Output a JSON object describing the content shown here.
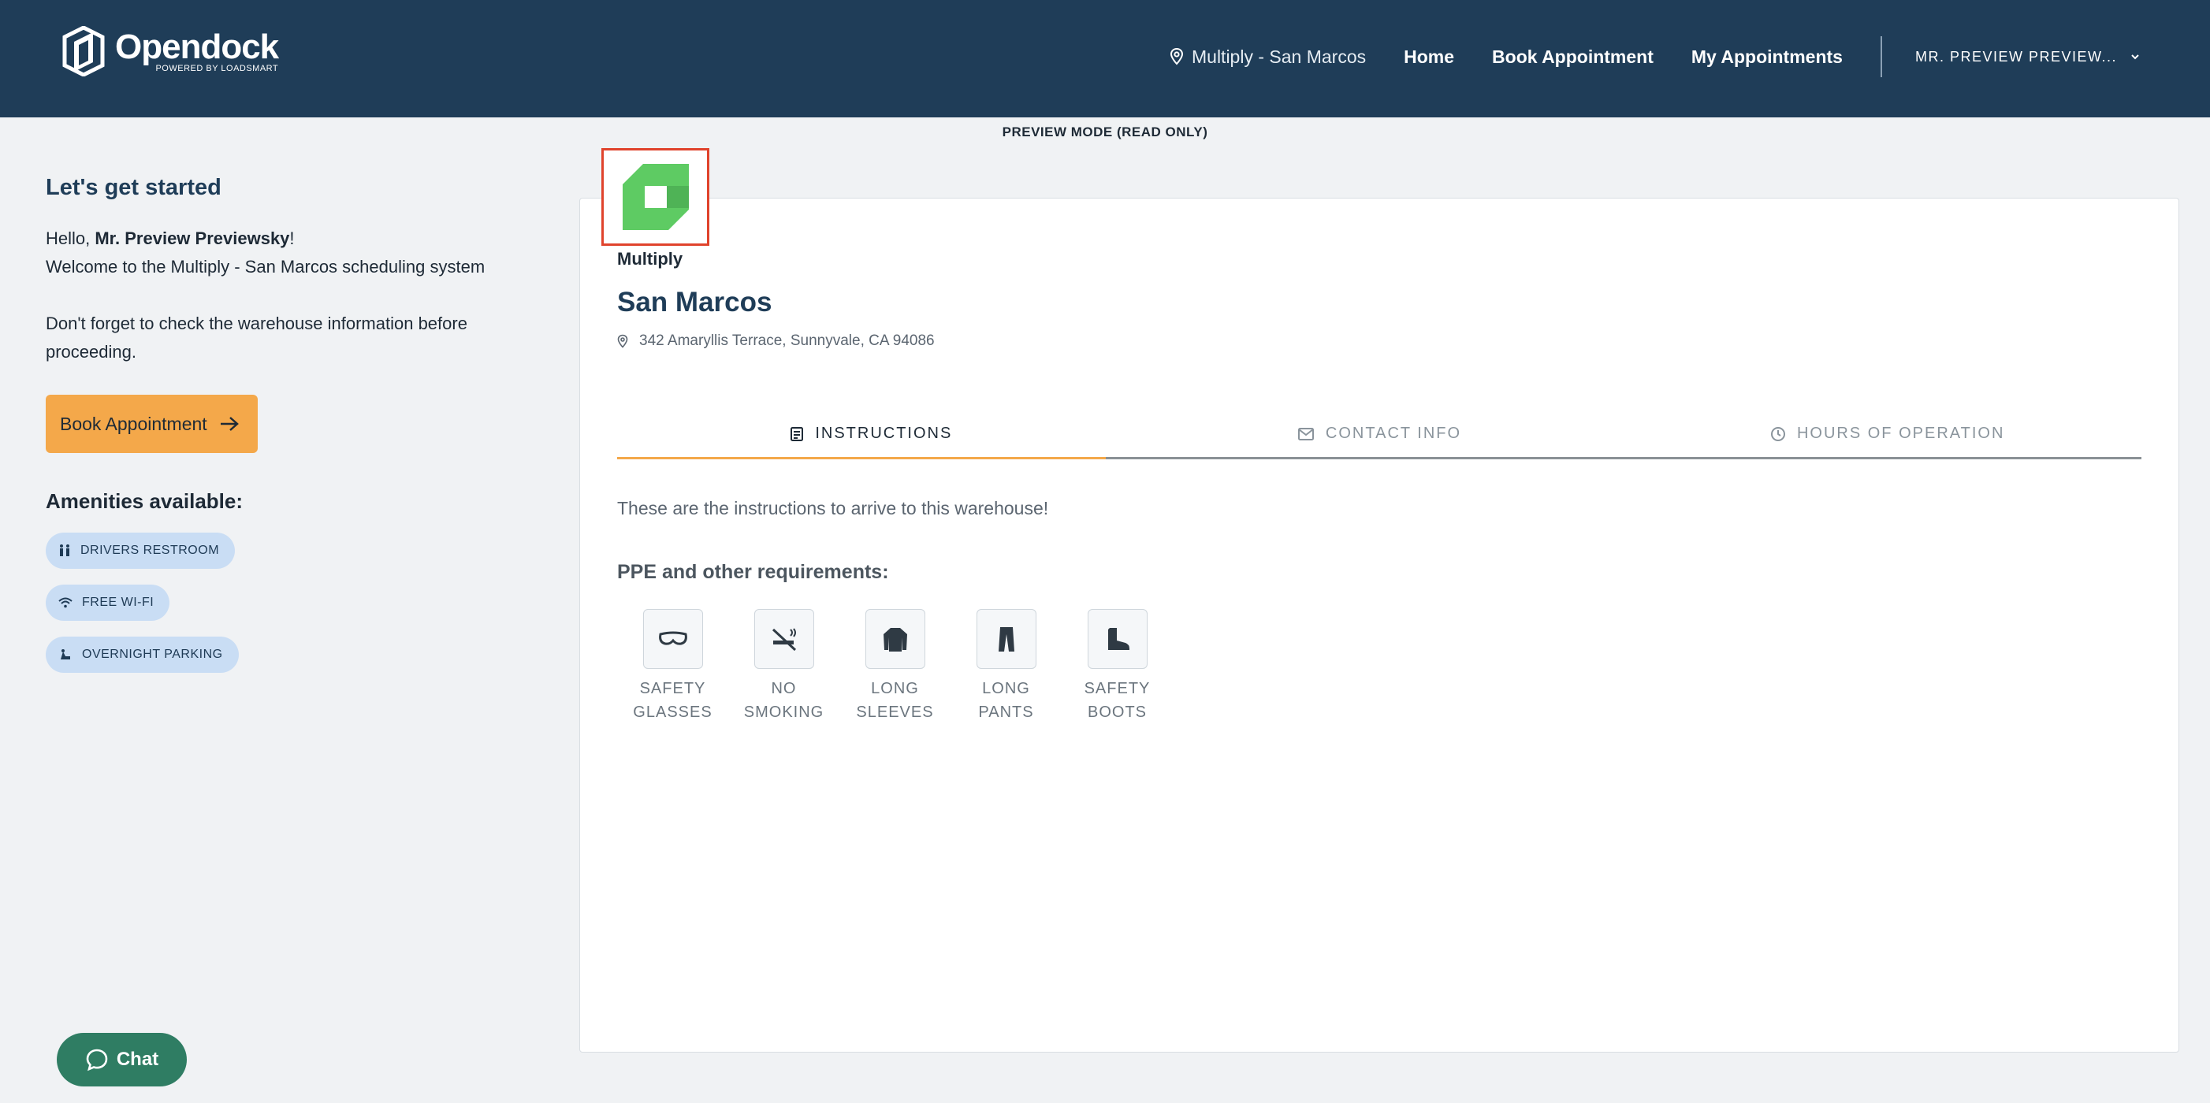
{
  "header": {
    "brand": "Opendock",
    "brand_sub": "POWERED BY LOADSMART",
    "location": "Multiply - San Marcos",
    "nav": [
      "Home",
      "Book Appointment",
      "My Appointments"
    ],
    "user": "MR. PREVIEW PREVIEW..."
  },
  "banner": "PREVIEW MODE (READ ONLY)",
  "sidebar": {
    "title": "Let's get started",
    "hello_prefix": "Hello, ",
    "user_name": "Mr. Preview Previewsky",
    "hello_suffix": "!",
    "welcome": "Welcome to the Multiply - San Marcos scheduling system",
    "reminder": "Don't forget to check the warehouse information before proceeding.",
    "book_label": "Book Appointment",
    "amenities_title": "Amenities available:",
    "amenities": [
      "DRIVERS RESTROOM",
      "FREE WI-FI",
      "OVERNIGHT PARKING"
    ]
  },
  "warehouse": {
    "org": "Multiply",
    "name": "San Marcos",
    "address": "342 Amaryllis Terrace, Sunnyvale, CA 94086"
  },
  "tabs": [
    "INSTRUCTIONS",
    "CONTACT INFO",
    "HOURS OF OPERATION"
  ],
  "instructions": "These are the instructions to arrive to this warehouse!",
  "ppe_title": "PPE and other requirements:",
  "ppe": [
    "SAFETY\nGLASSES",
    "NO\nSMOKING",
    "LONG\nSLEEVES",
    "LONG\nPANTS",
    "SAFETY\nBOOTS"
  ],
  "chat_label": "Chat",
  "colors": {
    "header": "#1f3d58",
    "accent": "#f4a84a",
    "logo_green": "#5ecb63",
    "chat": "#2f7d63",
    "highlight": "#e0432c"
  }
}
